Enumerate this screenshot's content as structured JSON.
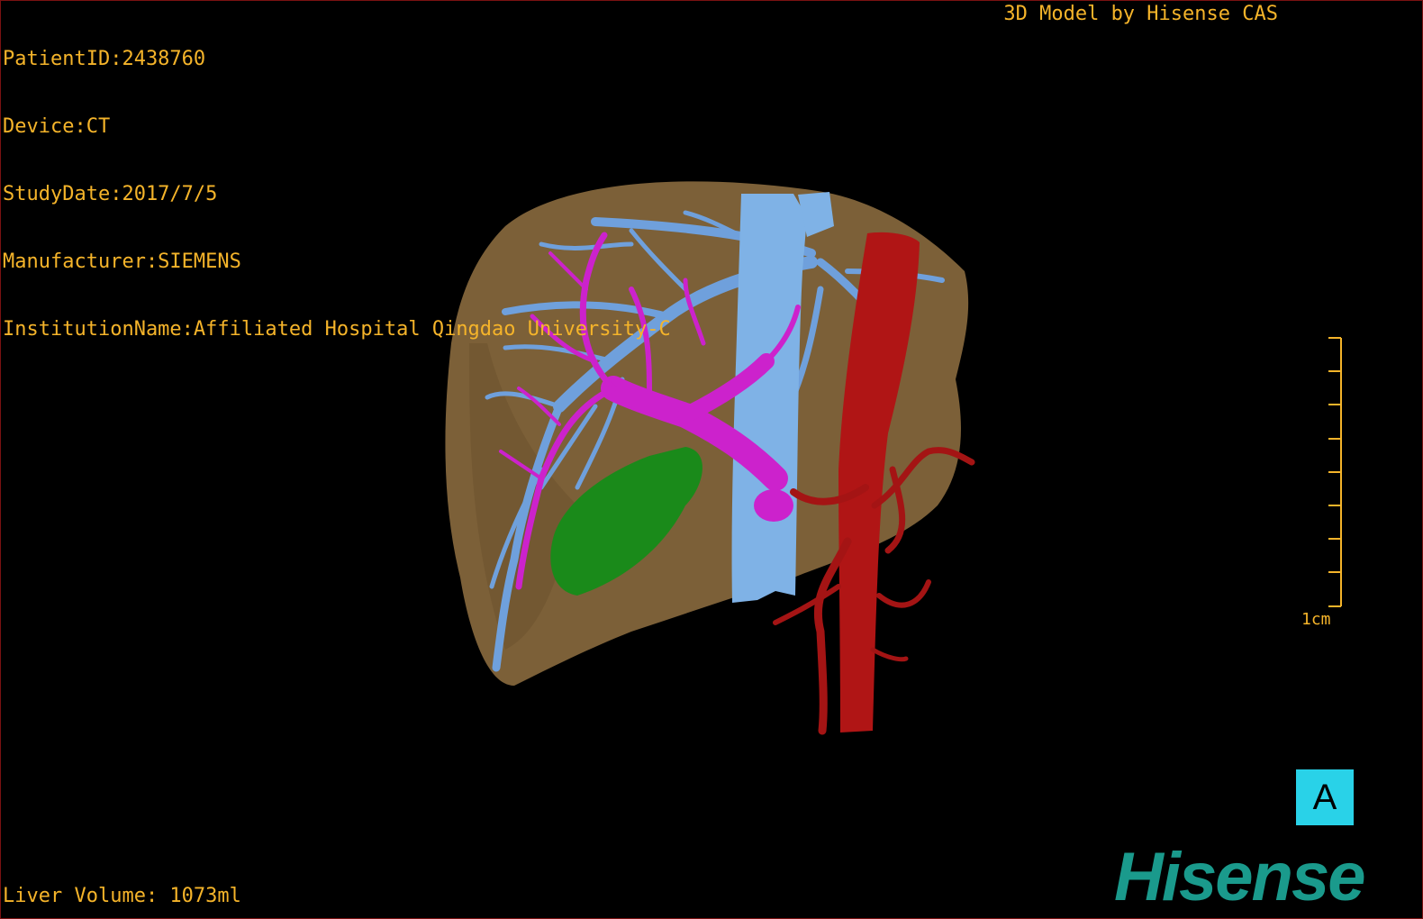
{
  "patient_info": {
    "patient_id": "PatientID:2438760",
    "device": "Device:CT",
    "study_date": "StudyDate:2017/7/5",
    "manufacturer": "Manufacturer:SIEMENS",
    "institution": "InstitutionName:Affiliated Hospital Qingdao University-C"
  },
  "credit": "3D Model by Hisense CAS",
  "liver_volume": "Liver Volume: 1073ml",
  "scale_label": "1cm",
  "view_label": "A",
  "brand": "Hisense",
  "colors": {
    "background": "#000000",
    "overlay_text": "#f5b42a",
    "liver": "#8a6a3e",
    "hepatic_veins": "#6fa0dc",
    "portal_vein": "#cc22cc",
    "aorta_arteries": "#b01515",
    "gallbladder": "#1a8a1a",
    "view_badge": "#29d2e8",
    "brand": "#1a9a8c"
  }
}
